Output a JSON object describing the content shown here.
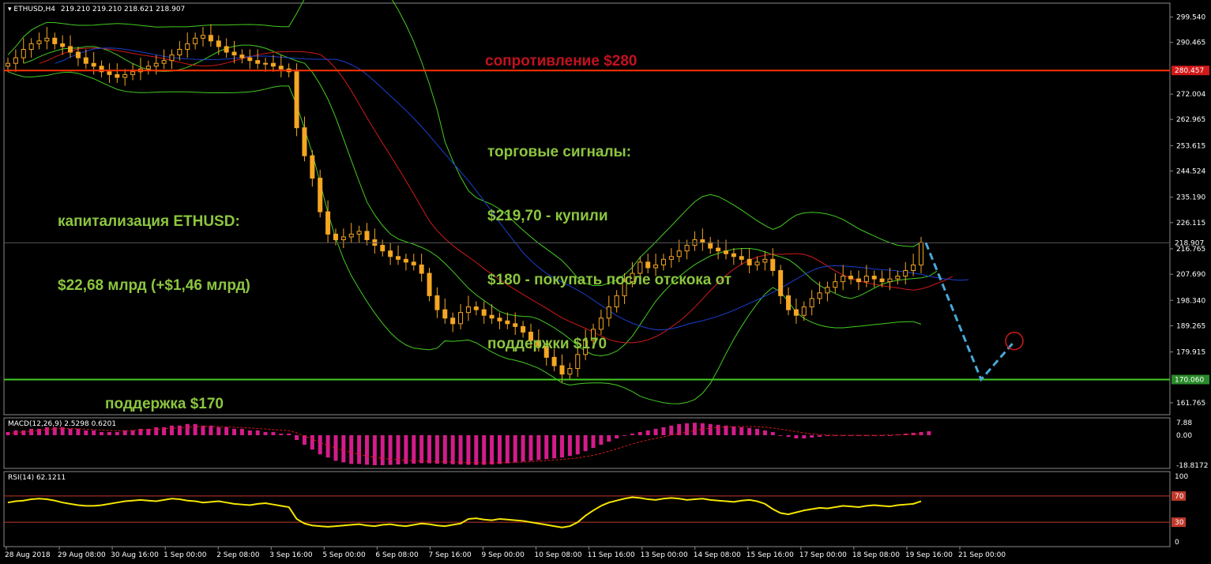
{
  "header": {
    "symbol": "ETHUSD,H4",
    "ohlc": "219.210 219.210 218.621 218.907",
    "macd_label": "MACD(12,26,9) 2.5298 0.6201",
    "rsi_label": "RSI(14) 62.1211"
  },
  "annotations": {
    "resistance": "сопротивление $280",
    "signals_title": "торговые сигналы:",
    "signal_1": "$219,70 - купили",
    "signal_2": "$180 - покупать после отскока от",
    "signal_3": "поддержки $170",
    "cap_title": "капитализация ETHUSD:",
    "cap_value": "$22,68 млрд (+$1,46 млрд)",
    "support": "поддержка $170"
  },
  "colors": {
    "background": "#000000",
    "grid": "#2a2a2a",
    "candle": "#f5a623",
    "resistance_line": "#ff3300",
    "support_line": "#44cc22",
    "bollinger": "#44cc22",
    "ma_fast": "#2a6a2a",
    "ma_red": "#d11a1a",
    "ma_blue": "#1a3fd1",
    "forecast": "#4aa8d8",
    "target_circle": "#d11a1a",
    "macd_hist": "#d41c8a",
    "rsi_line": "#f5e500",
    "rsi_levels": "#c0392b",
    "label_price": "#d11a1a",
    "label_support": "#2a8a2a"
  },
  "chart_data": {
    "type": "candlestick",
    "price_axis": {
      "range": [
        157.5,
        304.5
      ],
      "ticks": [
        "299.540",
        "290.465",
        "272.004",
        "262.965",
        "253.615",
        "244.524",
        "235.190",
        "226.115",
        "216.765",
        "207.690",
        "198.340",
        "189.265",
        "179.915",
        "161.765"
      ],
      "tick_values": [
        299.54,
        290.465,
        272.004,
        262.965,
        253.615,
        244.524,
        235.19,
        226.115,
        216.765,
        207.69,
        198.34,
        189.265,
        179.915,
        161.765
      ],
      "current_price": "218.907",
      "resistance_level": "280.457",
      "support_level": "170.060"
    },
    "time_axis": {
      "labels": [
        "28 Aug 2018",
        "29 Aug 08:00",
        "30 Aug 16:00",
        "1 Sep 00:00",
        "2 Sep 08:00",
        "3 Sep 16:00",
        "5 Sep 00:00",
        "6 Sep 08:00",
        "7 Sep 16:00",
        "9 Sep 00:00",
        "10 Sep 08:00",
        "11 Sep 16:00",
        "13 Sep 00:00",
        "14 Sep 08:00",
        "15 Sep 16:00",
        "17 Sep 00:00",
        "18 Sep 08:00",
        "19 Sep 16:00",
        "21 Sep 00:00"
      ]
    },
    "close_series": [
      283,
      285,
      288,
      290,
      291,
      292,
      290,
      289,
      287,
      285,
      283,
      282,
      280,
      279,
      278,
      279,
      280,
      281,
      282,
      283,
      284,
      286,
      288,
      290,
      292,
      293,
      291,
      289,
      287,
      286,
      285,
      284,
      283,
      283,
      282,
      281,
      280,
      260,
      250,
      242,
      230,
      222,
      220,
      221,
      222,
      223,
      220,
      218,
      216,
      214,
      213,
      212,
      211,
      208,
      200,
      195,
      192,
      190,
      194,
      196,
      195,
      193,
      192,
      191,
      190,
      189,
      187,
      184,
      182,
      178,
      175,
      172,
      174,
      179,
      184,
      188,
      192,
      196,
      200,
      205,
      208,
      212,
      210,
      211,
      213,
      214,
      216,
      218,
      220,
      219,
      217,
      216,
      215,
      214,
      213,
      211,
      212,
      213,
      209,
      200,
      195,
      193,
      196,
      199,
      201,
      203,
      205,
      207,
      206,
      205,
      207,
      206,
      205,
      206,
      207,
      209,
      211,
      219
    ],
    "macd": {
      "label": "MACD(12,26,9) 2.5298 0.6201",
      "ticks": [
        "7.88",
        "0.00",
        "-18.8172"
      ],
      "histogram": [
        2,
        3,
        3,
        4,
        4,
        5,
        5,
        5,
        4,
        4,
        3,
        3,
        2,
        2,
        2,
        3,
        3,
        4,
        4,
        5,
        5,
        6,
        6,
        7,
        7,
        6,
        6,
        5,
        5,
        4,
        4,
        3,
        3,
        2,
        2,
        1,
        1,
        -3,
        -6,
        -9,
        -12,
        -14,
        -16,
        -17,
        -18,
        -18,
        -18.5,
        -18.8,
        -18.8,
        -18.6,
        -18.3,
        -18,
        -17.8,
        -17.5,
        -17.6,
        -17.8,
        -18,
        -18.2,
        -18.3,
        -18.5,
        -18.6,
        -18.5,
        -18.3,
        -18,
        -17.6,
        -17,
        -16.5,
        -16,
        -15.5,
        -15,
        -14.5,
        -14,
        -13,
        -12,
        -10,
        -8,
        -6,
        -4,
        -2,
        0,
        1,
        2,
        3,
        4,
        5,
        6,
        7,
        7.5,
        7.8,
        7.5,
        7,
        6.5,
        6,
        5.5,
        5,
        4.5,
        4,
        3,
        2,
        0,
        -1,
        -2,
        -2,
        -1.5,
        -1,
        -0.5,
        0,
        0,
        0,
        0,
        0,
        0,
        0,
        0,
        0.5,
        1,
        1.5,
        2,
        2.5
      ],
      "signal": [
        1,
        1.5,
        2,
        2.5,
        3,
        3.5,
        4,
        4.2,
        4.2,
        4,
        3.8,
        3.5,
        3.2,
        3,
        2.8,
        2.8,
        3,
        3.2,
        3.4,
        3.6,
        4,
        4.3,
        4.6,
        5,
        5.3,
        5.5,
        5.5,
        5.4,
        5.2,
        5,
        4.8,
        4.5,
        4.2,
        3.9,
        3.5,
        3.2,
        2.8,
        1.5,
        -0.5,
        -2.5,
        -4.5,
        -6.5,
        -8,
        -9.5,
        -10.8,
        -12,
        -13,
        -13.8,
        -14.5,
        -15,
        -15.4,
        -15.7,
        -16,
        -16.2,
        -16.3,
        -16.5,
        -16.6,
        -16.8,
        -17,
        -17.1,
        -17.2,
        -17.3,
        -17.3,
        -17.3,
        -17.2,
        -17,
        -16.8,
        -16.5,
        -16.2,
        -15.9,
        -15.5,
        -15.2,
        -14.7,
        -14.2,
        -13.4,
        -12.5,
        -11.4,
        -10,
        -8.6,
        -7,
        -5.5,
        -4.2,
        -3,
        -2,
        -1,
        0,
        1,
        2,
        3,
        3.8,
        4.4,
        4.8,
        5.1,
        5.3,
        5.4,
        5.4,
        5.3,
        5,
        4.5,
        3.8,
        3,
        2.2,
        1.4,
        0.8,
        0.4,
        0.1,
        0,
        0,
        0,
        0,
        0,
        0,
        0,
        0.1,
        0.2,
        0.4,
        0.6,
        0.8
      ]
    },
    "rsi": {
      "label": "RSI(14) 62.1211",
      "ticks": [
        "100",
        "70",
        "30",
        "0"
      ],
      "levels": [
        70,
        30
      ],
      "values": [
        60,
        62,
        63,
        65,
        66,
        65,
        63,
        60,
        58,
        56,
        55,
        55,
        56,
        58,
        60,
        62,
        63,
        64,
        63,
        62,
        64,
        66,
        65,
        63,
        62,
        60,
        61,
        62,
        60,
        58,
        57,
        56,
        58,
        59,
        57,
        55,
        53,
        35,
        28,
        25,
        24,
        23,
        24,
        25,
        26,
        27,
        25,
        24,
        26,
        27,
        25,
        24,
        26,
        28,
        27,
        25,
        24,
        26,
        28,
        35,
        36,
        34,
        33,
        35,
        34,
        33,
        32,
        30,
        28,
        26,
        24,
        22,
        24,
        30,
        40,
        48,
        55,
        60,
        63,
        66,
        68,
        67,
        65,
        64,
        66,
        67,
        66,
        64,
        65,
        66,
        64,
        63,
        62,
        61,
        63,
        64,
        62,
        58,
        50,
        44,
        42,
        45,
        48,
        50,
        52,
        51,
        53,
        55,
        54,
        53,
        55,
        56,
        55,
        54,
        56,
        57,
        58,
        62
      ]
    },
    "forecast": [
      218.9,
      170.06,
      183
    ]
  }
}
